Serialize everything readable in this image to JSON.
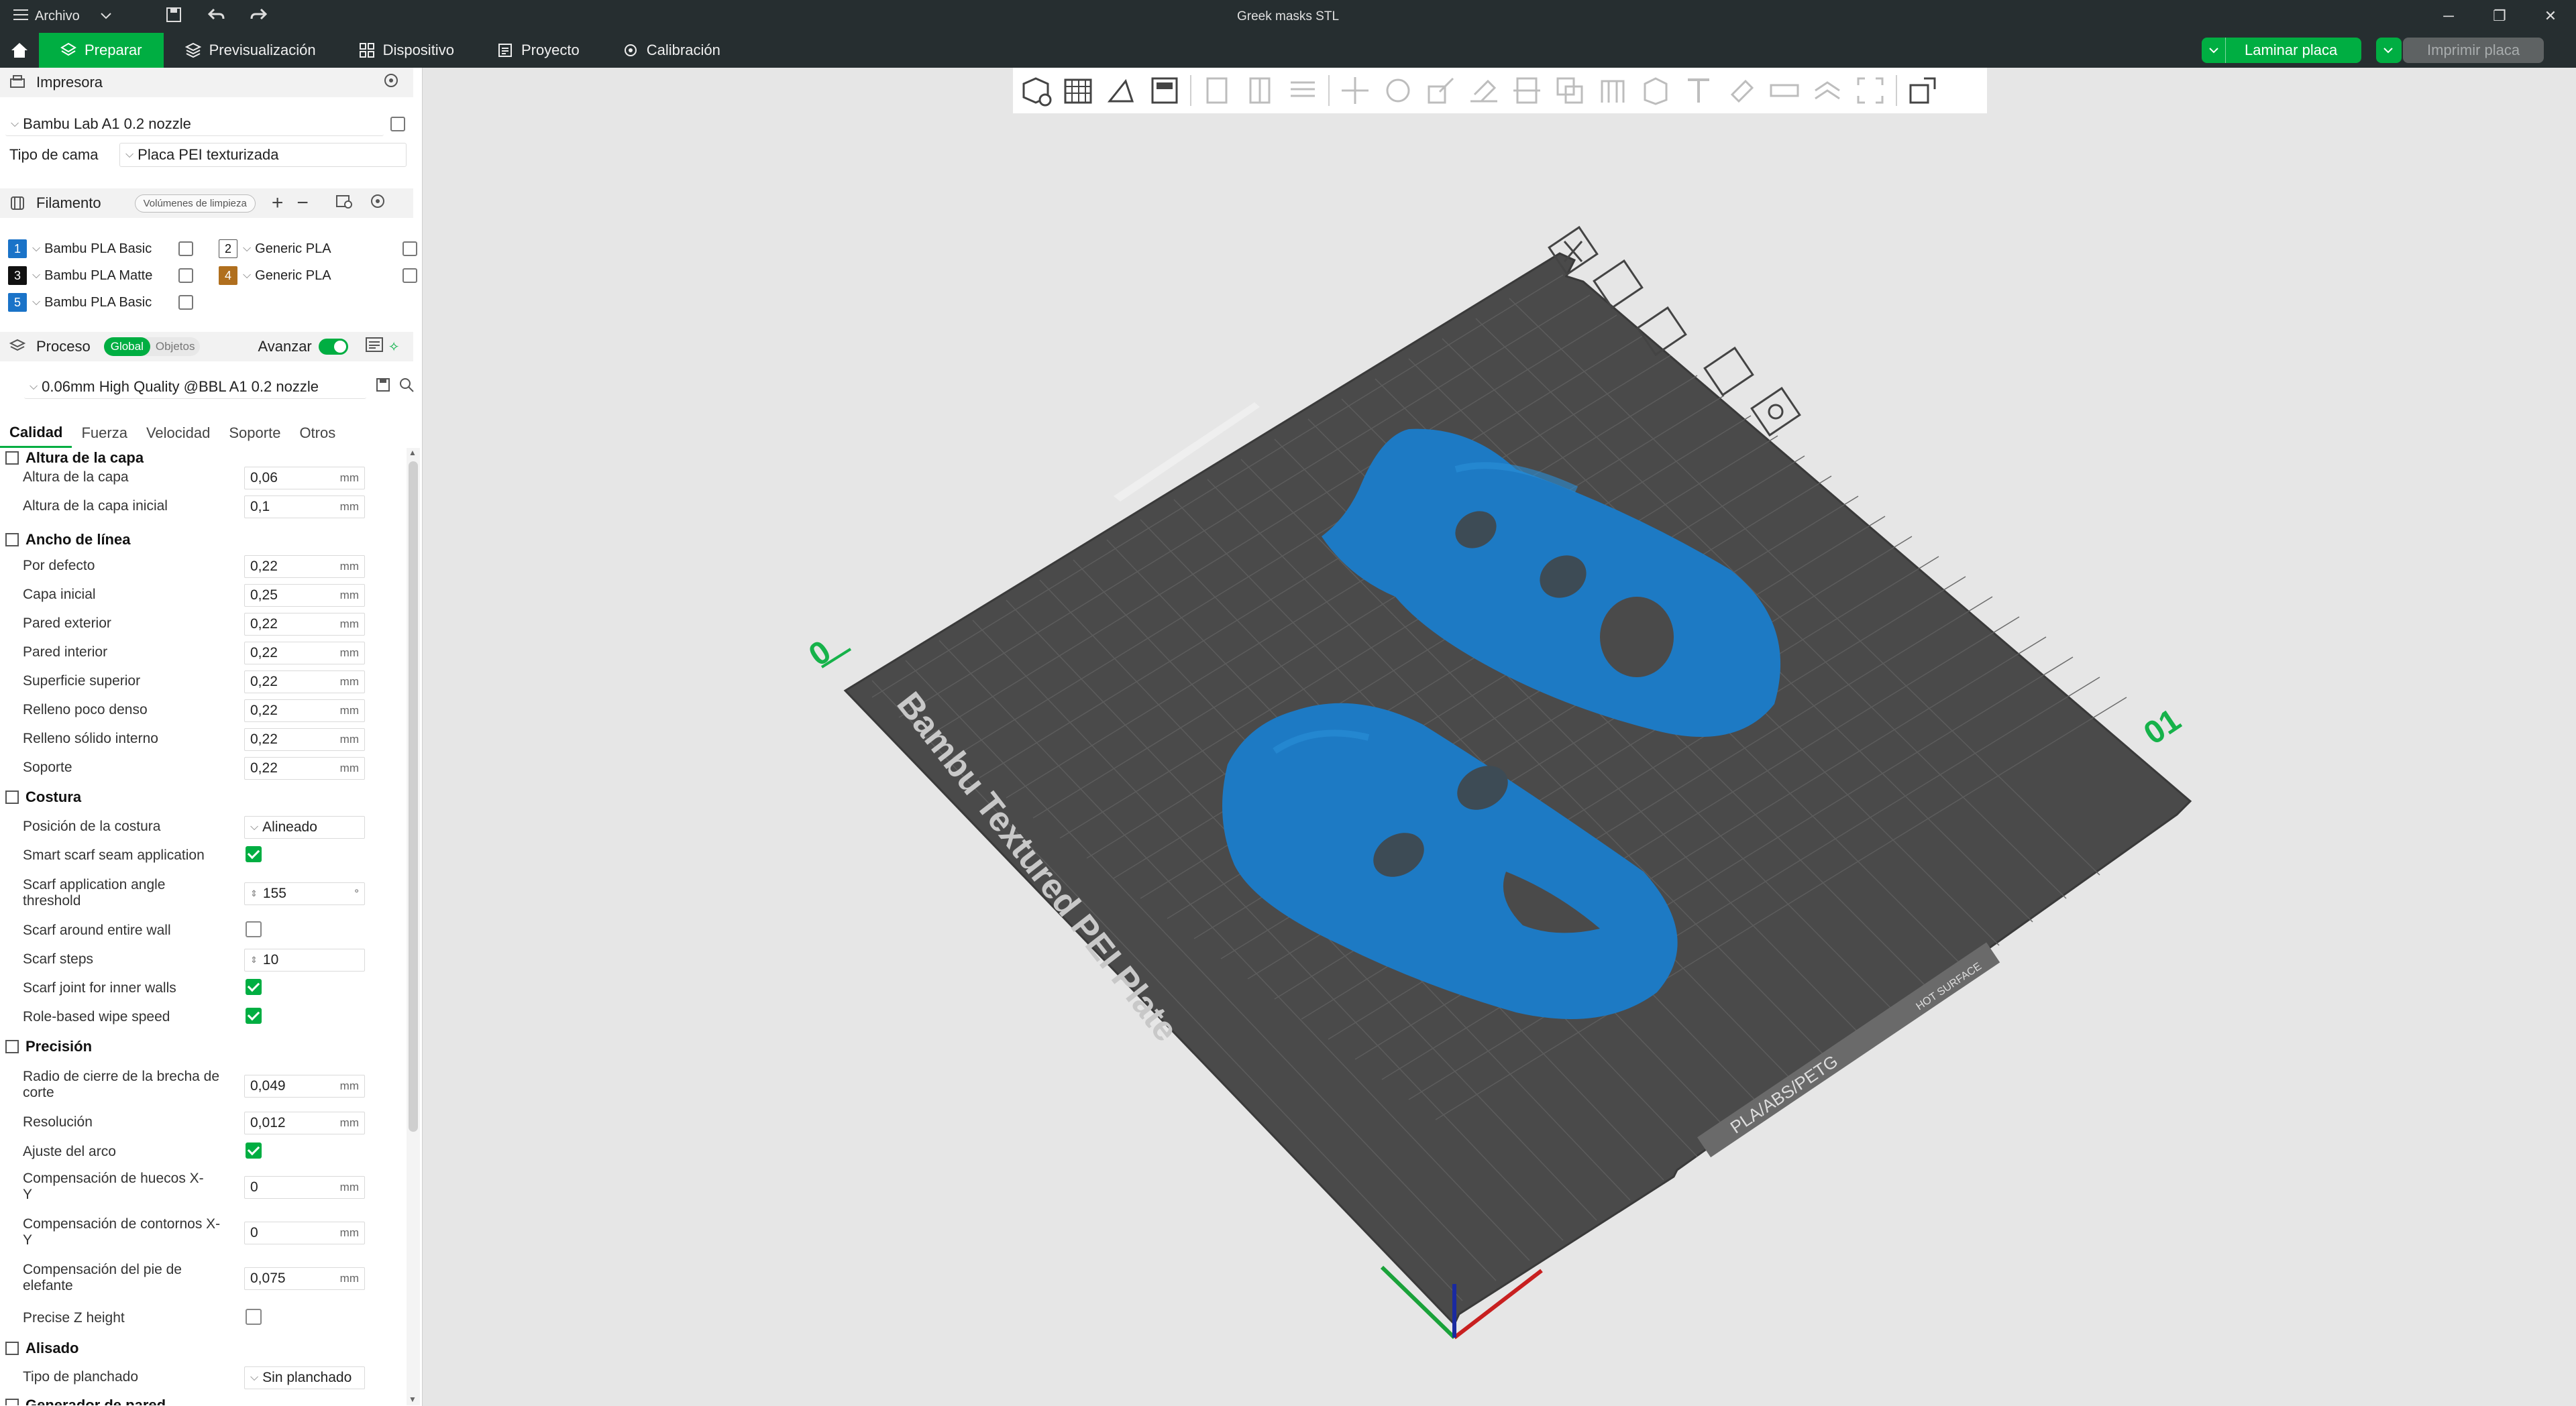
{
  "window": {
    "title": "Greek masks STL",
    "menu_label": "Archivo"
  },
  "nav": {
    "tabs": [
      {
        "label": "Preparar",
        "active": true
      },
      {
        "label": "Previsualización"
      },
      {
        "label": "Dispositivo"
      },
      {
        "label": "Proyecto"
      },
      {
        "label": "Calibración"
      }
    ],
    "slice_button": "Laminar placa",
    "print_button": "Imprimir placa"
  },
  "printer": {
    "section_label": "Impresora",
    "name": "Bambu Lab A1 0.2 nozzle",
    "bed_type_label": "Tipo de cama",
    "bed_type_value": "Placa PEI texturizada"
  },
  "filament": {
    "section_label": "Filamento",
    "flush_button": "Volúmenes de limpieza",
    "items": [
      {
        "num": "1",
        "name": "Bambu PLA Basic",
        "color": "#1a73c8"
      },
      {
        "num": "2",
        "name": "Generic PLA",
        "color": "#ffffff"
      },
      {
        "num": "3",
        "name": "Bambu PLA Matte",
        "color": "#111111"
      },
      {
        "num": "4",
        "name": "Generic PLA",
        "color": "#b06f1e"
      },
      {
        "num": "5",
        "name": "Bambu PLA Basic",
        "color": "#1a73c8"
      }
    ]
  },
  "process": {
    "section_label": "Proceso",
    "toggle_global": "Global",
    "toggle_objects": "Objetos",
    "advanced_label": "Avanzar",
    "profile": "0.06mm High Quality @BBL A1 0.2 nozzle",
    "tabs": [
      "Calidad",
      "Fuerza",
      "Velocidad",
      "Soporte",
      "Otros"
    ]
  },
  "settings": {
    "g1": "Altura de la capa",
    "layer_height_label": "Altura de la capa",
    "layer_height": "0,06",
    "initial_layer_height_label": "Altura de la capa inicial",
    "initial_layer_height": "0,1",
    "g2": "Ancho de línea",
    "lw_default_label": "Por defecto",
    "lw_default": "0,22",
    "lw_initial_label": "Capa inicial",
    "lw_initial": "0,25",
    "lw_outer_label": "Pared exterior",
    "lw_outer": "0,22",
    "lw_inner_label": "Pared interior",
    "lw_inner": "0,22",
    "lw_top_label": "Superficie superior",
    "lw_top": "0,22",
    "lw_sparse_label": "Relleno poco denso",
    "lw_sparse": "0,22",
    "lw_solid_label": "Relleno sólido interno",
    "lw_solid": "0,22",
    "lw_support_label": "Soporte",
    "lw_support": "0,22",
    "g3": "Costura",
    "seam_pos_label": "Posición de la costura",
    "seam_pos": "Alineado",
    "smart_scarf_label": "Smart scarf seam application",
    "scarf_angle_label": "Scarf application angle threshold",
    "scarf_angle": "155",
    "scarf_angle_unit": "°",
    "scarf_entire_label": "Scarf around entire wall",
    "scarf_steps_label": "Scarf steps",
    "scarf_steps": "10",
    "scarf_inner_label": "Scarf joint for inner walls",
    "role_wipe_label": "Role-based wipe speed",
    "g4": "Precisión",
    "slice_gap_label": "Radio de cierre de la brecha de corte",
    "slice_gap": "0,049",
    "resolution_label": "Resolución",
    "resolution": "0,012",
    "arc_fit_label": "Ajuste del arco",
    "xy_hole_label": "Compensación de huecos X-Y",
    "xy_hole": "0",
    "xy_contour_label": "Compensación de contornos X-Y",
    "xy_contour": "0",
    "elephant_label": "Compensación del pie de elefante",
    "elephant": "0,075",
    "precise_z_label": "Precise Z height",
    "g5": "Alisado",
    "ironing_label": "Tipo de planchado",
    "ironing": "Sin planchado",
    "g6": "Generador de pared",
    "unit_mm": "mm"
  },
  "plate": {
    "name": "Bambu Textured PEI Plate",
    "filaments_text": "PLA/ABS/PETG",
    "hot_text": "HOT SURFACE",
    "num_01": "01",
    "num_0": "0"
  }
}
